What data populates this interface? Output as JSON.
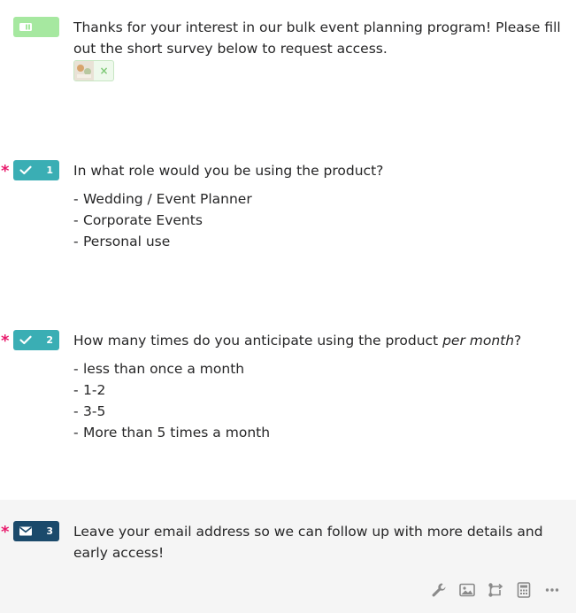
{
  "welcome": {
    "text": "Thanks for your interest in our bulk event planning program! Please fill out the short survey below to request access.",
    "attachment_remove": "×"
  },
  "questions": [
    {
      "number": "1",
      "required": "*",
      "type": "multiple-choice",
      "text": "In what role would you be using the product?",
      "choices": [
        "Wedding / Event Planner",
        "Corporate Events",
        "Personal use"
      ]
    },
    {
      "number": "2",
      "required": "*",
      "type": "multiple-choice",
      "text_before": "How many times do you anticipate using the product ",
      "text_emphasis": "per month",
      "text_after": "?",
      "choices": [
        "less than once a month",
        "1-2",
        "3-5",
        "More than 5 times a month"
      ]
    },
    {
      "number": "3",
      "required": "*",
      "type": "email",
      "text": "Leave your email address so we can follow up with more details and early access!"
    }
  ],
  "toolbar": {
    "icons": [
      "wrench-icon",
      "image-icon",
      "logic-jump-icon",
      "calculator-icon",
      "more-icon"
    ]
  },
  "colors": {
    "welcome_badge": "#a6e8a0",
    "choice_badge": "#3aaeb4",
    "email_badge": "#1b4a6b",
    "required": "#e8196b",
    "selected_background": "#f5f5f5"
  }
}
